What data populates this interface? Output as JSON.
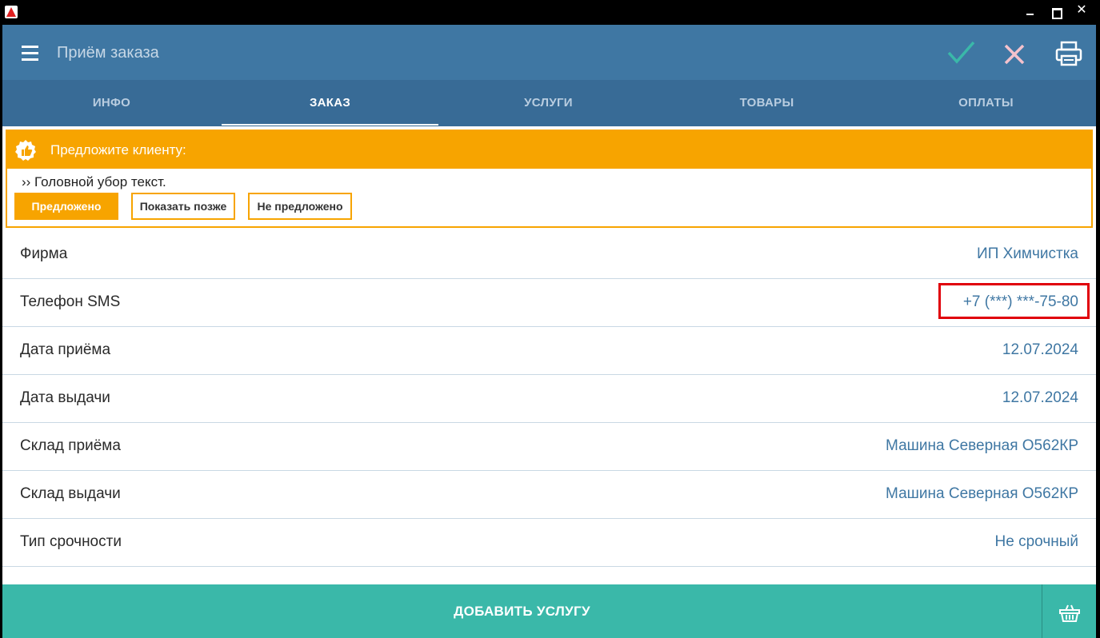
{
  "window": {
    "title": "Приём заказа"
  },
  "tabs": [
    {
      "label": "ИНФО"
    },
    {
      "label": "ЗАКАЗ"
    },
    {
      "label": "УСЛУГИ"
    },
    {
      "label": "ТОВАРЫ"
    },
    {
      "label": "ОПЛАТЫ"
    }
  ],
  "active_tab": "ЗАКАЗ",
  "promo": {
    "title": "Предложите клиенту:",
    "text": "›› Головной убор текст.",
    "buttons": {
      "offered": "Предложено",
      "show_later": "Показать позже",
      "not_offered": "Не предложено"
    }
  },
  "fields": [
    {
      "label": "Фирма",
      "value": "ИП Химчистка"
    },
    {
      "label": "Телефон SMS",
      "value": "+7 (***) ***-75-80"
    },
    {
      "label": "Дата приёма",
      "value": "12.07.2024"
    },
    {
      "label": "Дата выдачи",
      "value": "12.07.2024"
    },
    {
      "label": "Склад приёма",
      "value": "Машина Северная О562КР"
    },
    {
      "label": "Склад выдачи",
      "value": "Машина Северная О562КР"
    },
    {
      "label": "Тип срочности",
      "value": "Не срочный"
    }
  ],
  "footer": {
    "add_service": "ДОБАВИТЬ УСЛУГУ"
  },
  "colors": {
    "appbar": "#3f77a3",
    "tabbar": "#386b96",
    "promo_accent": "#f7a400",
    "footer": "#3ab8a9",
    "value_text": "#3f77a3",
    "highlight": "#e0000a"
  },
  "icons": {
    "menu": "hamburger-icon",
    "confirm": "check-icon",
    "cancel": "close-icon",
    "print": "printer-icon",
    "promo": "badge-thumb-icon",
    "basket": "basket-icon"
  }
}
